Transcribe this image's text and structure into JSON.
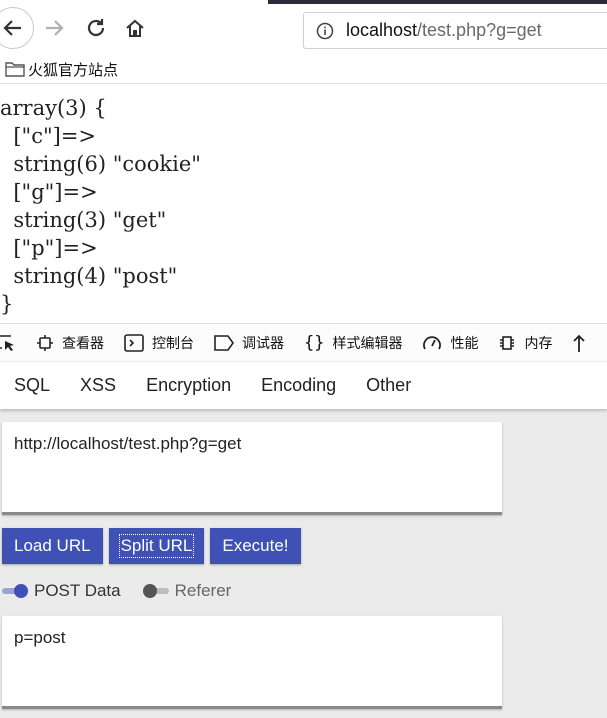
{
  "browser": {
    "url_host": "localhost",
    "url_path": "/test.php?g=get",
    "bookmark": "火狐官方站点"
  },
  "page": {
    "dump_lines": [
      "array(3) {",
      "  [\"c\"]=>",
      "  string(6) \"cookie\"",
      "  [\"g\"]=>",
      "  string(3) \"get\"",
      "  [\"p\"]=>",
      "  string(4) \"post\"",
      "}"
    ]
  },
  "devtools": {
    "tabs": [
      "查看器",
      "控制台",
      "调试器",
      "样式编辑器",
      "性能",
      "内存"
    ]
  },
  "hackbar": {
    "menu": [
      "SQL",
      "XSS",
      "Encryption",
      "Encoding",
      "Other"
    ],
    "url_value": "http://localhost/test.php?g=get",
    "buttons": [
      "Load URL",
      "Split URL",
      "Execute!"
    ],
    "post_toggle": "POST Data",
    "referer_toggle": "Referer",
    "post_value": "p=post",
    "accent": "#3f51b5"
  }
}
